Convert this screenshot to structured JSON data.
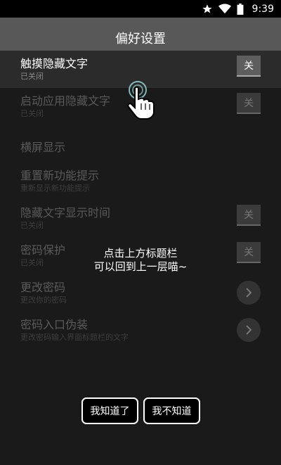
{
  "status": {
    "time": "9:39",
    "icons": [
      "star-icon",
      "wifi-icon",
      "battery-icon"
    ]
  },
  "title": "偏好设置",
  "settings": [
    {
      "label": "触摸隐藏文字",
      "sub": "已关闭",
      "control": "toggle",
      "value": "关"
    },
    {
      "label": "启动应用隐藏文字",
      "sub": "已关闭",
      "control": "toggle",
      "value": "关"
    },
    {
      "label": "横屏显示",
      "sub": "",
      "control": "none"
    },
    {
      "label": "重置新功能提示",
      "sub": "重新显示新功能提示",
      "control": "none"
    },
    {
      "label": "隐藏文字显示时间",
      "sub": "已关闭",
      "control": "toggle",
      "value": "关"
    },
    {
      "label": "密码保护",
      "sub": "已关闭",
      "control": "toggle",
      "value": "关"
    },
    {
      "label": "更改密码",
      "sub": "更改你的密码",
      "control": "chevron"
    },
    {
      "label": "密码入口伪装",
      "sub": "更改密码输入界面标题栏的文字",
      "control": "chevron"
    }
  ],
  "hint": {
    "line1": "点击上方标题栏",
    "line2": "可以回到上一层喵~"
  },
  "buttons": {
    "ok": "我知道了",
    "no": "我不知道"
  }
}
